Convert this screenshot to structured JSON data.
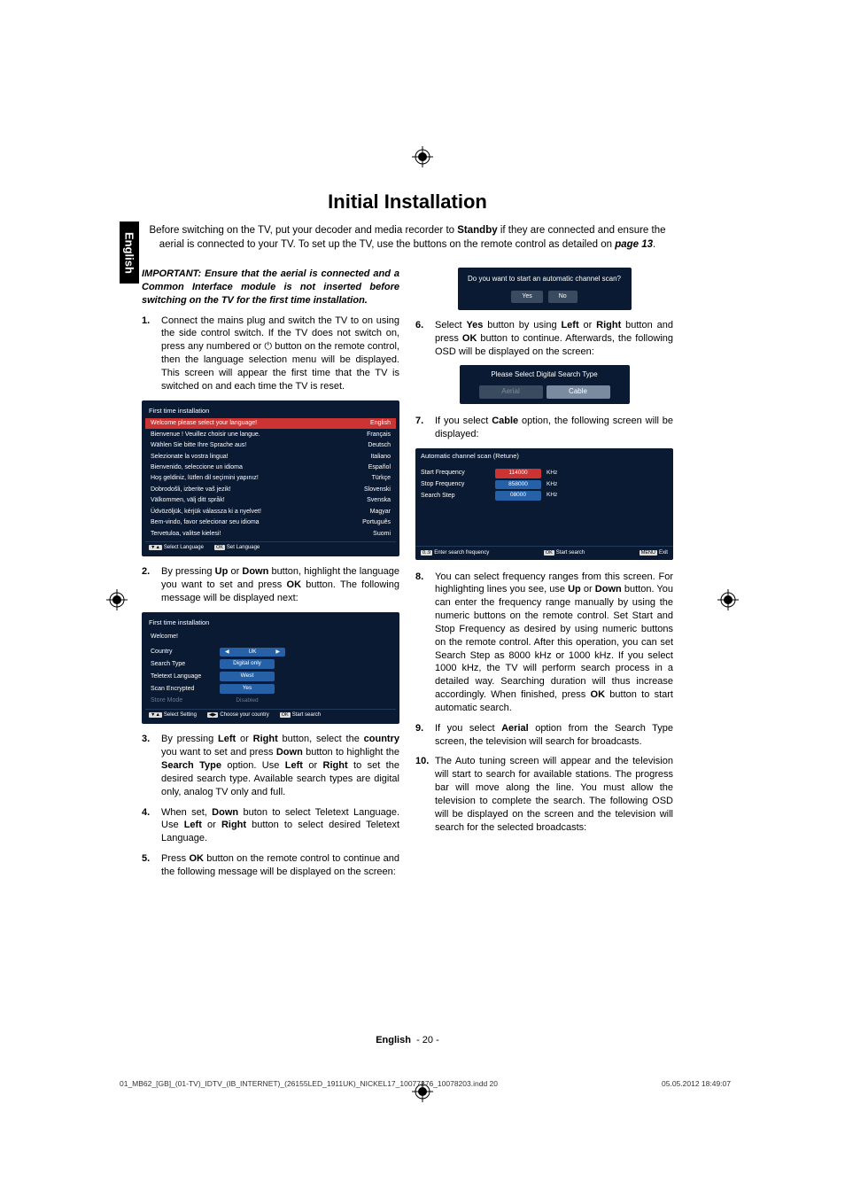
{
  "sideTab": "English",
  "title": "Initial Installation",
  "intro_a": "Before switching on the TV, put your decoder and media recorder to ",
  "intro_bold": "Standby",
  "intro_b": " if they are connected and ensure the aerial is connected to your TV. To set up the TV, use the buttons on the remote control as detailed on ",
  "intro_page_bold": "page 13",
  "intro_c": ".",
  "important": "IMPORTANT: Ensure that the aerial is connected and a Common Interface module is not inserted before switching on the TV for the first time installation.",
  "step1": "Connect the mains plug and switch the TV to on using the side control switch. If the TV does not switch on, press any numbered or ⏻ button on the remote control, then the language selection menu will be displayed. This screen will appear the first time that the TV is switched on and each time the TV is reset.",
  "osd1": {
    "title": "First time installation",
    "sel_left": "Welcome please select your language!",
    "sel_right": "English",
    "rows": [
      [
        "Bienvenue ! Veuillez choisir une langue.",
        "Français"
      ],
      [
        "Wählen Sie bitte Ihre Sprache aus!",
        "Deutsch"
      ],
      [
        "Selezionate la vostra lingua!",
        "Italiano"
      ],
      [
        "Bienvenido, seleccione un idioma",
        "Español"
      ],
      [
        "Hoş geldiniz, lütfen dil seçimini yapınız!",
        "Türkçe"
      ],
      [
        "Dobrodošli, izberite vaš jezik!",
        "Slovenski"
      ],
      [
        "Välkommen, välj ditt språk!",
        "Svenska"
      ],
      [
        "Üdvözöljük, kérjük válassza ki a nyelvet!",
        "Magyar"
      ],
      [
        "Bem-vindo, favor selecionar seu idioma",
        "Português"
      ],
      [
        "Tervetuloa, valitse kielesi!",
        "Suomi"
      ]
    ],
    "footer_a_key": "▼▲",
    "footer_a_text": "Select Language",
    "footer_b_key": "OK",
    "footer_b_text": "Set Language"
  },
  "step2_a": "By pressing ",
  "step2_b": " or ",
  "step2_c": " button, highlight the language you want to set and press ",
  "step2_d": " button. The following message will be displayed next:",
  "step2_up": "Up",
  "step2_down": "Down",
  "step2_ok": "OK",
  "osd2": {
    "title": "First time installation",
    "welcome": "Welcome!",
    "rows": [
      {
        "label": "Country",
        "val": "UK",
        "sel": true
      },
      {
        "label": "Search Type",
        "val": "Digital only",
        "sel": false
      },
      {
        "label": "Teletext Language",
        "val": "West",
        "sel": false
      },
      {
        "label": "Scan Encrypted",
        "val": "Yes",
        "sel": false
      },
      {
        "label": "Store Mode",
        "val": "Disabled",
        "sel": false,
        "dim": true
      }
    ],
    "footer": [
      {
        "key": "▼▲",
        "text": "Select Setting"
      },
      {
        "key": "◀▶",
        "text": "Choose your country"
      },
      {
        "key": "OK",
        "text": "Start search"
      }
    ]
  },
  "step3_a": "By pressing ",
  "step3_left": "Left",
  "step3_b": " or ",
  "step3_right": "Right",
  "step3_c": " button, select the ",
  "step3_country": "country",
  "step3_d": " you want to set and press ",
  "step3_down": "Down",
  "step3_e": " button to highlight the ",
  "step3_st": "Search Type",
  "step3_f": " option. Use ",
  "step3_g": " to set the desired search type. Available search types are digital only, analog TV only and full.",
  "step4_a": "When set, ",
  "step4_down": "Down",
  "step4_b": " buton to select Teletext Language. Use ",
  "step4_left": "Left",
  "step4_c": " or ",
  "step4_right": "Right",
  "step4_d": " button to select desired Teletext Language.",
  "step5_a": "Press ",
  "step5_ok": "OK",
  "step5_b": " button on the remote control to continue and the following message will be displayed on the screen:",
  "osd_scan_q": "Do you want to start an automatic channel scan?",
  "osd_yes": "Yes",
  "osd_no": "No",
  "step6_a": "Select ",
  "step6_yes": "Yes",
  "step6_b": " button by using ",
  "step6_left": "Left",
  "step6_c": " or ",
  "step6_right": "Right",
  "step6_d": " button and press ",
  "step6_ok": "OK",
  "step6_e": " button to continue. Afterwards, the following OSD will be displayed on the screen:",
  "osd_search_title": "Please Select Digital Search Type",
  "osd_aerial": "Aerial",
  "osd_cable": "Cable",
  "step7_a": "If you select ",
  "step7_cable": "Cable",
  "step7_b": " option, the following screen will be displayed:",
  "osd_retune": {
    "title": "Automatic channel scan (Retune)",
    "rows": [
      {
        "label": "Start Frequency",
        "val": "114000",
        "unit": "KHz",
        "sel": true
      },
      {
        "label": "Stop Frequency",
        "val": "858000",
        "unit": "KHz",
        "sel": false
      },
      {
        "label": "Search Step",
        "val": "08000",
        "unit": "KHz",
        "sel": false
      }
    ],
    "footer": [
      {
        "key": "0..9",
        "text": "Enter search frequency"
      },
      {
        "key": "OK",
        "text": "Start search"
      },
      {
        "key": "MENU",
        "text": "Exit"
      }
    ]
  },
  "step8_a": "You can select frequency ranges from this screen. For highlighting lines you see, use ",
  "step8_up": "Up",
  "step8_b": " or ",
  "step8_down": "Down",
  "step8_c": " button. You can enter the frequency range manually by using the numeric buttons on the remote control. Set Start and Stop Frequency as desired by using numeric buttons on the remote control. After this operation, you can set Search Step as 8000 kHz or 1000 kHz. If you select 1000 kHz, the TV will perform search process in a detailed way. Searching duration will thus increase accordingly. When finished, press ",
  "step8_ok": "OK",
  "step8_d": " button to start automatic search.",
  "step9_a": "If you select ",
  "step9_aerial": "Aerial",
  "step9_b": " option from the Search Type screen, the television will search for broadcasts.",
  "step10": "The Auto tuning screen will appear and the television will start to search for available stations. The progress bar will move along the line. You must allow the television to complete the search. The following OSD will be displayed on the screen and the television will search for the selected broadcasts:",
  "pageFooter_lang": "English",
  "pageFooter_num": "- 20 -",
  "indd_left": "01_MB62_[GB]_(01-TV)_IDTV_(IB_INTERNET)_(26155LED_1911UK)_NICKEL17_10077276_10078203.indd   20",
  "indd_right": "05.05.2012   18:49:07"
}
